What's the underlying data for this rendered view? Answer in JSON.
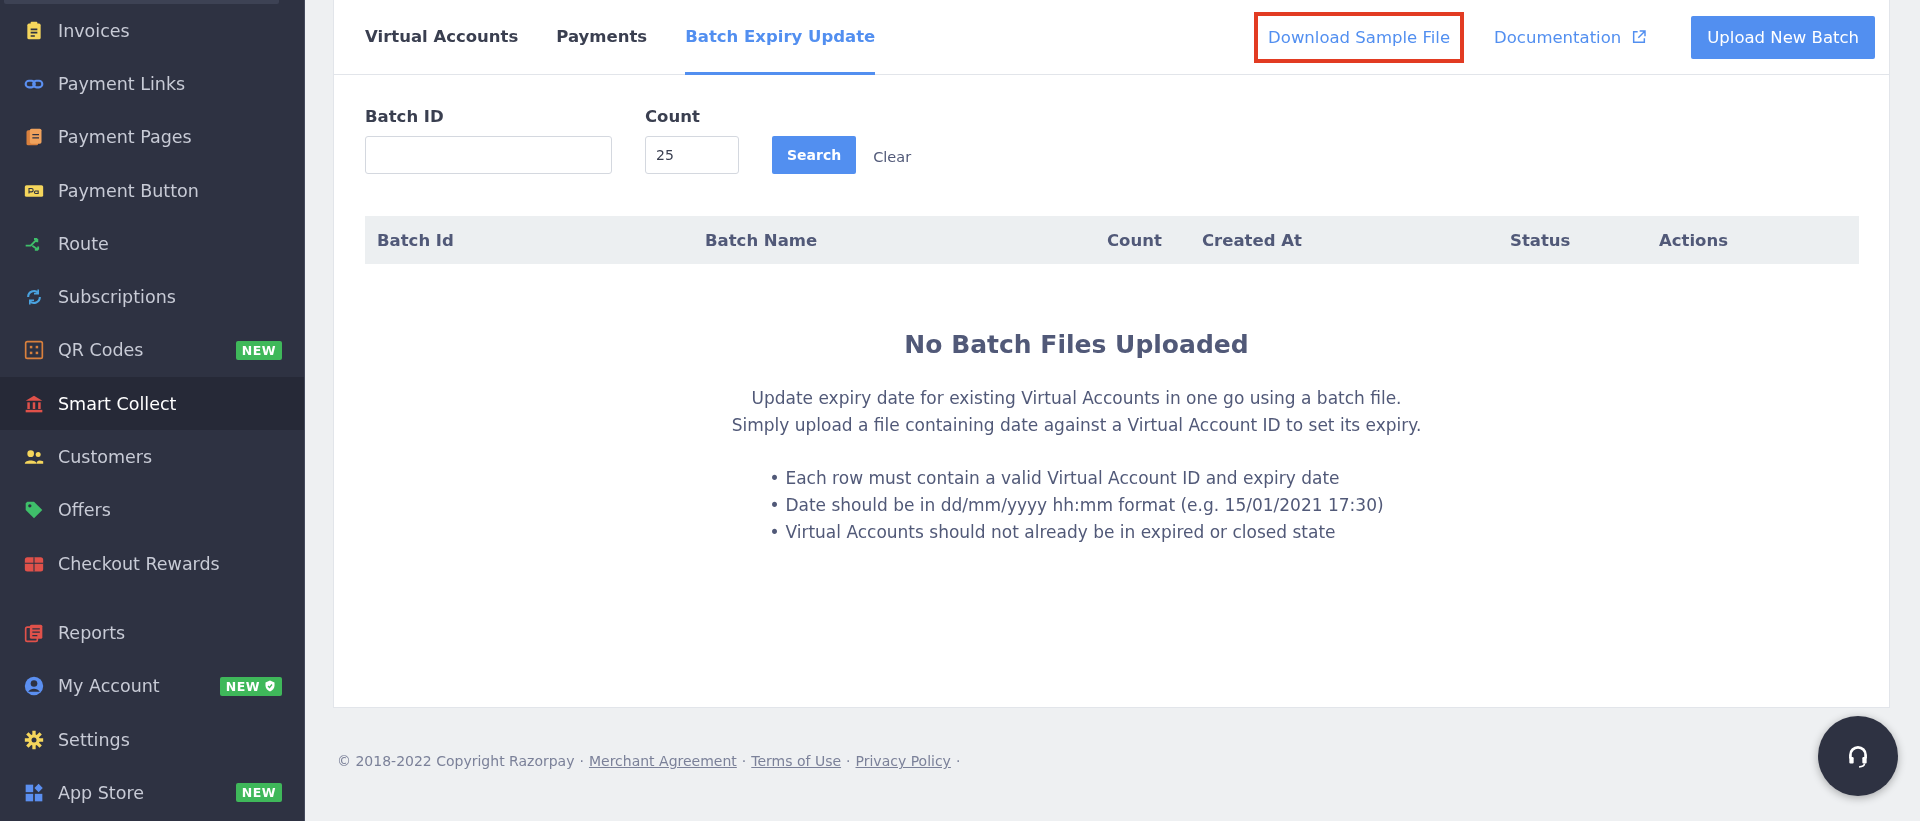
{
  "sidebar": {
    "groups": [
      {
        "items": [
          {
            "label": "Invoices",
            "selected": false
          },
          {
            "label": "Payment Links",
            "selected": false
          },
          {
            "label": "Payment Pages",
            "selected": false
          },
          {
            "label": "Payment Button",
            "selected": false
          },
          {
            "label": "Route",
            "selected": false
          },
          {
            "label": "Subscriptions",
            "selected": false
          },
          {
            "label": "QR Codes",
            "selected": false,
            "badge": "NEW"
          },
          {
            "label": "Smart Collect",
            "selected": true
          },
          {
            "label": "Customers",
            "selected": false
          },
          {
            "label": "Offers",
            "selected": false
          },
          {
            "label": "Checkout Rewards",
            "selected": false
          }
        ]
      },
      {
        "items": [
          {
            "label": "Reports",
            "selected": false
          },
          {
            "label": "My Account",
            "selected": false,
            "badge": "NEW",
            "badge_shield": true
          },
          {
            "label": "Settings",
            "selected": false
          },
          {
            "label": "App Store",
            "selected": false,
            "badge": "NEW"
          }
        ]
      }
    ]
  },
  "tabs": [
    {
      "label": "Virtual Accounts",
      "selected": false
    },
    {
      "label": "Payments",
      "selected": false
    },
    {
      "label": "Batch Expiry Update",
      "selected": true
    }
  ],
  "header_actions": {
    "download_sample_file": {
      "label": "Download Sample File",
      "highlighted": true
    },
    "documentation": {
      "label": "Documentation"
    },
    "upload_button": "Upload New Batch"
  },
  "filters": {
    "fields": [
      {
        "label": "Batch ID"
      },
      {
        "label": "Count",
        "value": "25"
      }
    ],
    "search_button": "Search",
    "clear_button": "Clear"
  },
  "table": {
    "columns": [
      "Batch Id",
      "Batch Name",
      "Count",
      "Created At",
      "Status",
      "Actions"
    ]
  },
  "empty_state": {
    "title": "No Batch Files Uploaded",
    "description": [
      "Update expiry date for existing Virtual Accounts in one go using a batch file.",
      "Simply upload a file containing date against a Virtual Account ID to set its expiry."
    ],
    "bullets": [
      "Each row must contain a valid Virtual Account ID and expiry date",
      "Date should be in dd/mm/yyyy hh:mm format (e.g. 15/01/2021 17:30)",
      "Virtual Accounts should not already be in expired or closed state"
    ],
    "bullet_mark": "•"
  },
  "footer": {
    "copyright": "© 2018-2022 Copyright Razorpay",
    "separator": "·",
    "links": [
      "Merchant Agreement",
      "Terms of Use",
      "Privacy Policy"
    ]
  }
}
